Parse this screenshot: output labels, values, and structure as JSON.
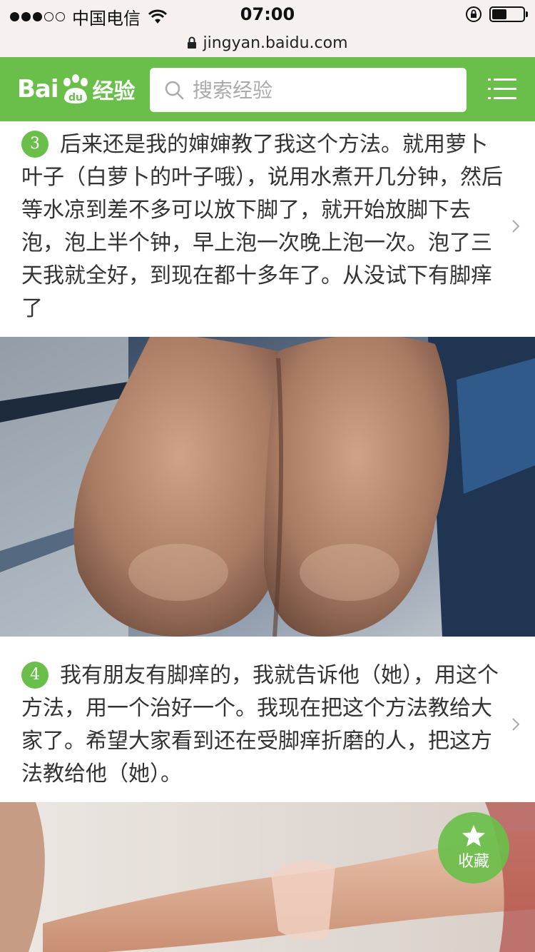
{
  "status_bar": {
    "carrier": "中国电信",
    "time": "07:00"
  },
  "url_bar": {
    "url": "jingyan.baidu.com"
  },
  "header": {
    "logo_bai": "Bai",
    "logo_du": "du",
    "logo_jingyan": "经验",
    "search_placeholder": "搜索经验"
  },
  "steps": [
    {
      "number": "3",
      "text": "后来还是我的婶婶教了我这个方法。就用萝卜叶子（白萝卜的叶子哦），说用水煮开几分钟，然后等水凉到差不多可以放下脚了，就开始放脚下去泡，泡上半个钟，早上泡一次晚上泡一次。泡了三天我就全好，到现在都十多年了。从没试下有脚痒了"
    },
    {
      "number": "4",
      "text": "我有朋友有脚痒的，我就告诉他（她），用这个方法，用一个治好一个。我现在把这个方法教给大家了。希望大家看到还在受脚痒折磨的人，把这方法教给他（她）。"
    }
  ],
  "favorite_button": {
    "label": "收藏"
  }
}
